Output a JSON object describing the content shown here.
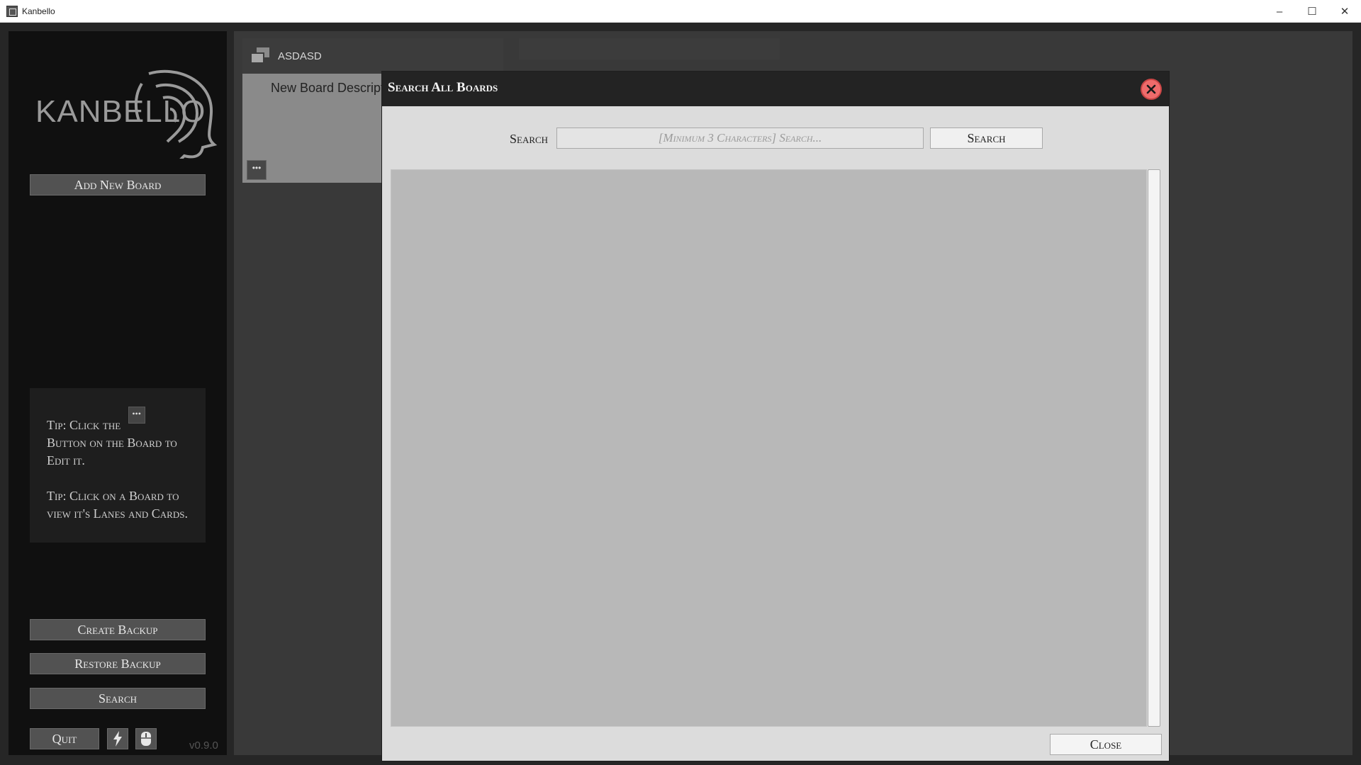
{
  "window": {
    "title": "Kanbello",
    "minimize": "–",
    "maximize": "☐",
    "close": "✕"
  },
  "sidebar": {
    "logo_text": "KANBELLO",
    "add_board": "Add New Board",
    "tip1_line1": "Tip: Click the",
    "tip1_dots": "•••",
    "tip1_line2": "Button on the Board to Edit it.",
    "tip2": "Tip: Click on a Board to view it's Lanes and Cards.",
    "create_backup": "Create Backup",
    "restore_backup": "Restore Backup",
    "search": "Search",
    "quit": "Quit",
    "version": "v0.9.0"
  },
  "board": {
    "title": "ASDASD",
    "description": "New Board Description",
    "menu_dots": "•••"
  },
  "modal": {
    "title": "Search All Boards",
    "search_label": "Search",
    "search_placeholder": "[Minimum 3 Characters] Search...",
    "search_button": "Search",
    "close_button": "Close"
  }
}
